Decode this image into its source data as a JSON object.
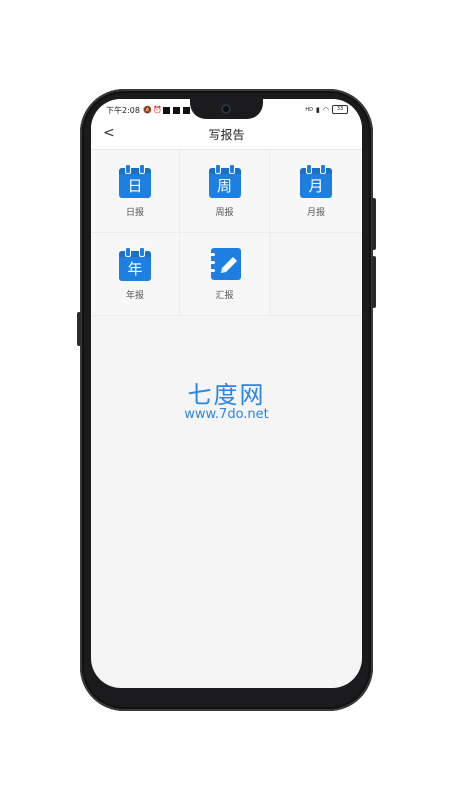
{
  "status_bar": {
    "time": "下午2:08",
    "battery": "33",
    "signal": "HD"
  },
  "header": {
    "back_icon": "chevron-left-icon",
    "back_glyph": "<",
    "title": "写报告"
  },
  "report_types": [
    {
      "label": "日报",
      "icon_text": "日",
      "icon": "calendar-icon"
    },
    {
      "label": "周报",
      "icon_text": "周",
      "icon": "calendar-icon"
    },
    {
      "label": "月报",
      "icon_text": "月",
      "icon": "calendar-icon"
    },
    {
      "label": "年报",
      "icon_text": "年",
      "icon": "calendar-icon"
    },
    {
      "label": "汇报",
      "icon_text": "",
      "icon": "notebook-pen-icon"
    }
  ],
  "watermark": {
    "main": "七度网",
    "url": "www.7do.net"
  },
  "colors": {
    "accent": "#1e7fe0",
    "background": "#f5f5f6",
    "phone_frame": "#1b1b1d",
    "watermark": "#2b86e3"
  }
}
